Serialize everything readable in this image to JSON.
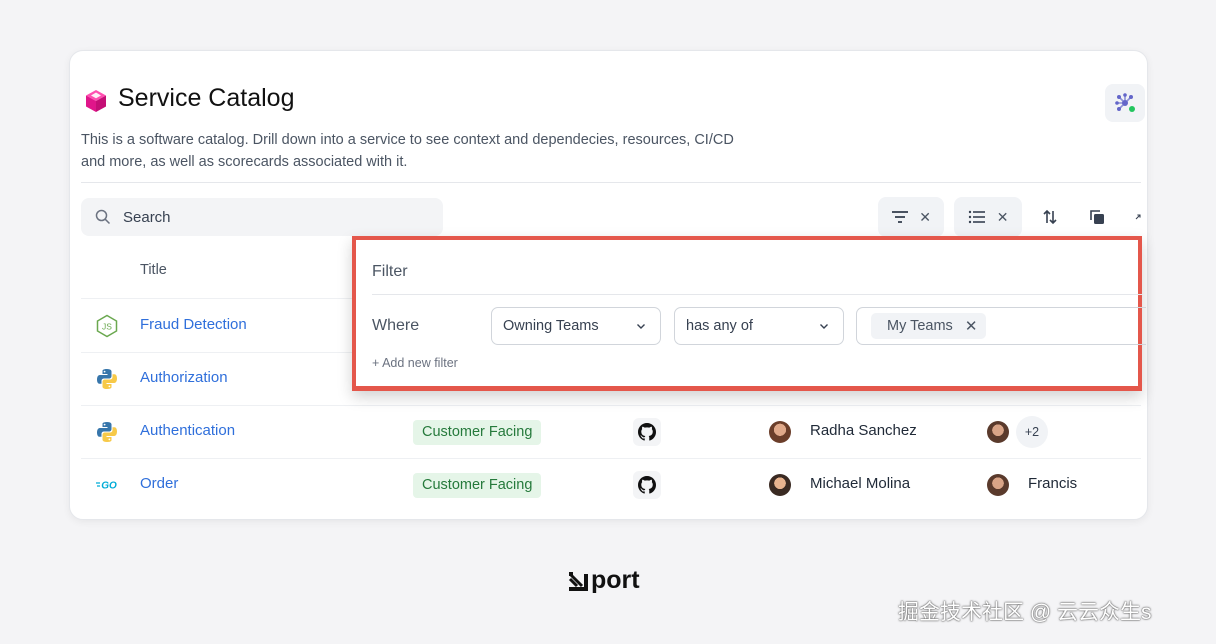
{
  "page": {
    "title": "Service Catalog",
    "description": "This is a software catalog. Drill down into a service to see context and dependecies, resources, CI/CD and more, as well as scorecards associated with it."
  },
  "search": {
    "placeholder": "Search"
  },
  "table": {
    "col_title": "Title",
    "rows": [
      {
        "name": "Fraud Detection",
        "language_icon": "nodejs-icon"
      },
      {
        "name": "Authorization",
        "language_icon": "python-icon"
      },
      {
        "name": "Authentication",
        "language_icon": "python-icon",
        "tag": "Customer Facing",
        "owner": "Radha Sanchez",
        "members_extra": "+2"
      },
      {
        "name": "Order",
        "language_icon": "go-icon",
        "tag": "Customer Facing",
        "owner": "Michael Molina",
        "member": "Francis"
      }
    ]
  },
  "filter": {
    "title": "Filter",
    "where": "Where",
    "field": "Owning Teams",
    "operator": "has any of",
    "value_chip": "My Teams",
    "chip_remove": "✕",
    "add_new": "+ Add new filter"
  },
  "toolbar": {
    "clear_x": "✕"
  },
  "brand": {
    "logo_text": "port",
    "watermark": "掘金技术社区 @ 云云众生s"
  },
  "colors": {
    "accent": "#2f6fdb",
    "highlight_border": "#e4574b",
    "tag_bg": "#e5f5e8",
    "tag_text": "#267a3c"
  }
}
